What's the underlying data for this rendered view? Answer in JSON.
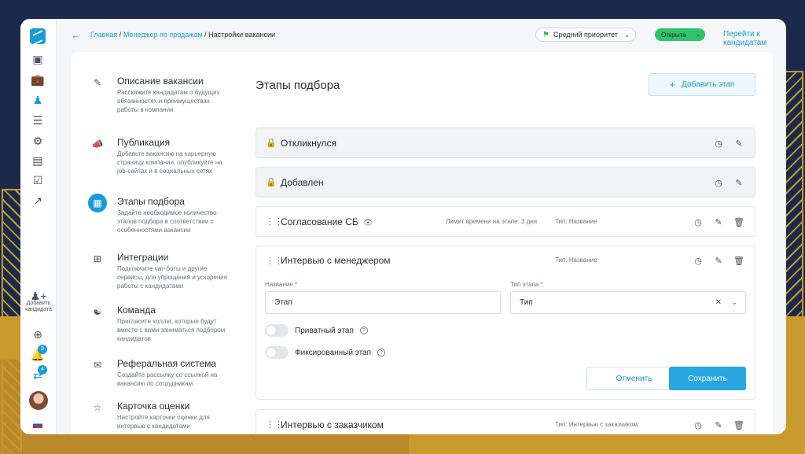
{
  "breadcrumb": {
    "home": "Главная",
    "parent": "Менеджер по продажам",
    "current": "Настройки вакансии",
    "sep": "/"
  },
  "header": {
    "priority": "Средний приоритет",
    "status": "Открыта",
    "goto_candidates": "Перейти к кандидатам"
  },
  "rail": {
    "add_candidate": "Добавить кандидата",
    "notifications_count": "3",
    "messages_count": "4"
  },
  "settings_nav": [
    {
      "title": "Описание вакансии",
      "desc": "Расскажите кандидатам о будущих обязанностях и преимуществах работы в компании",
      "icon": "pencil-icon"
    },
    {
      "title": "Публикация",
      "desc": "Добавьте вакансию на карьерную страницу компании, опубликуйте на job-сайтах и в социальных сетях",
      "icon": "megaphone-icon"
    },
    {
      "title": "Этапы подбора",
      "desc": "Задайте необходимое количество этапов подбора в соответствии с особенностями вакансии",
      "icon": "stages-icon"
    },
    {
      "title": "Интеграции",
      "desc": "Подключите чат-боты и другие сервисы, для упрощения и ускорения работы с кандидатами",
      "icon": "integrations-icon"
    },
    {
      "title": "Команда",
      "desc": "Пригласите коллег, которые будут вместе с вами заниматься подбором кандидатов",
      "icon": "team-icon"
    },
    {
      "title": "Реферальная система",
      "desc": "Создайте рассылку со ссылкой на вакансию по сотрудникам.",
      "icon": "referral-icon"
    },
    {
      "title": "Карточка оценки",
      "desc": "Настройте карточки оценки для интервью с кандидатами",
      "icon": "star-icon"
    }
  ],
  "stages": {
    "heading": "Этапы подбора",
    "add_button": "Добавить этап",
    "items": [
      {
        "name": "Откликнулся"
      },
      {
        "name": "Добавлен"
      },
      {
        "name": "Согласование СБ",
        "limit": "Лимит времени на этапе: 3 дня",
        "type": "Тип: Название"
      },
      {
        "name": "Интервью с менеджером",
        "type": "Тип: Название"
      },
      {
        "name": "Интервью с заказчиком",
        "type": "Тип: Интервью с заказчиком"
      }
    ]
  },
  "edit_form": {
    "name_label": "Название",
    "name_value": "Этап",
    "type_label": "Тип этапа",
    "type_value": "Тип",
    "required_mark": "*",
    "private_label": "Приватный этап",
    "fixed_label": "Фиксированный этап",
    "help_glyph": "?",
    "cancel": "Отменить",
    "save": "Сохранить"
  },
  "colors": {
    "accent": "#1a9bd7",
    "status_green": "#2fc36a",
    "save_button": "#2aa6e2"
  }
}
